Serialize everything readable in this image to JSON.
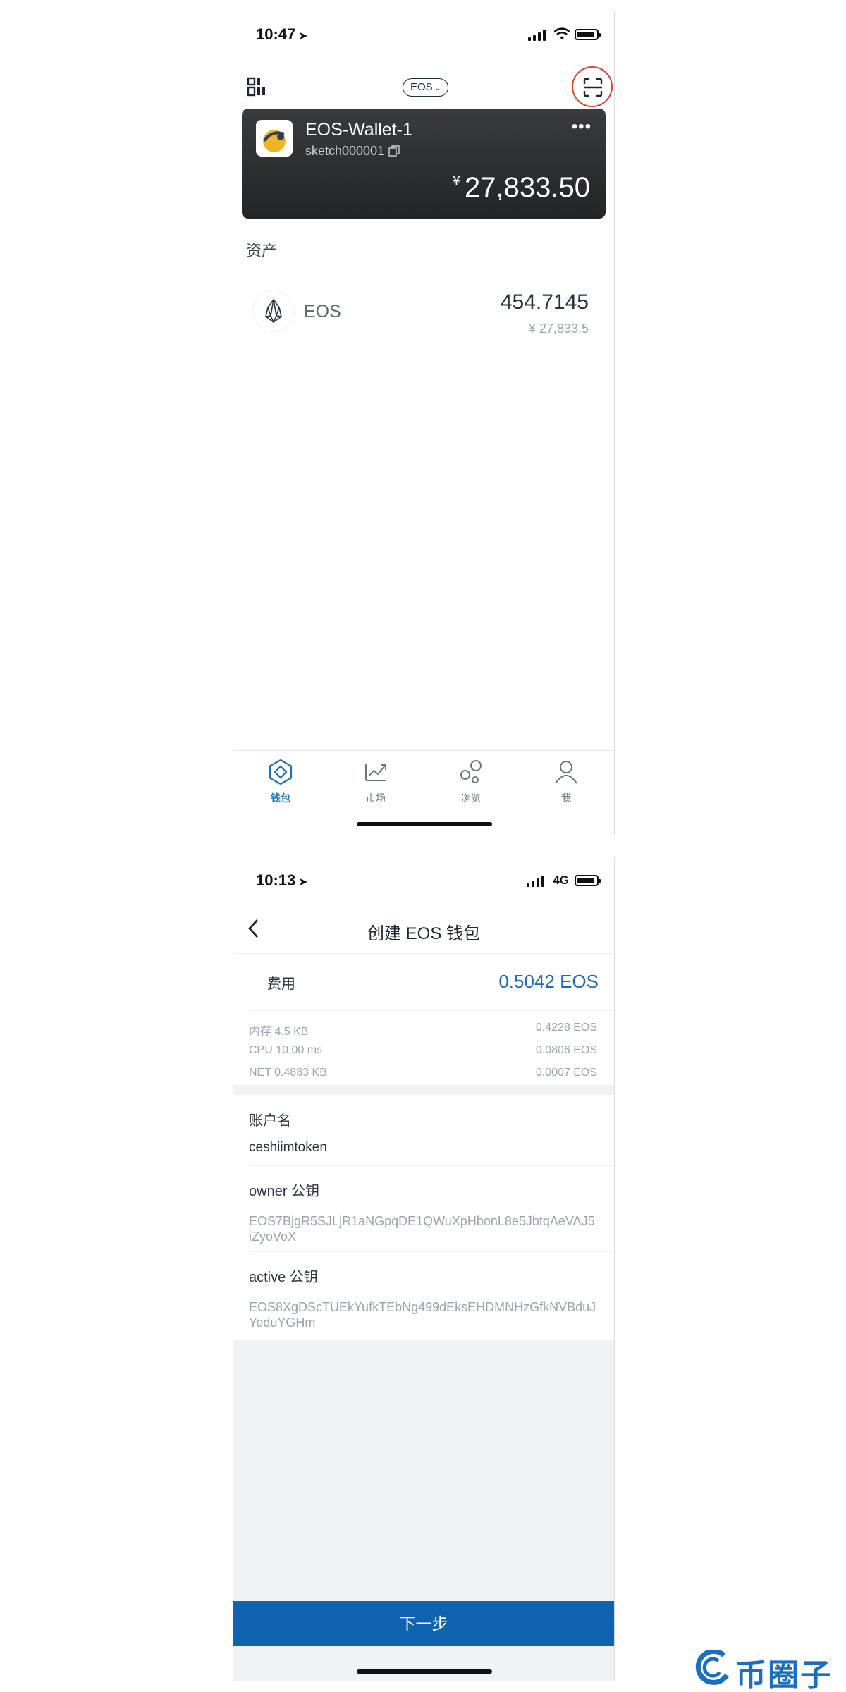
{
  "screen1": {
    "status": {
      "time": "10:47"
    },
    "topbar": {
      "chain": "EOS"
    },
    "wallet": {
      "name": "EOS-Wallet-1",
      "account": "sketch000001",
      "currency_symbol": "¥",
      "balance": "27,833.50"
    },
    "assets_title": "资产",
    "assets": [
      {
        "symbol": "EOS",
        "amount": "454.7145",
        "value": "¥ 27,833.5"
      }
    ],
    "tabs": [
      {
        "label": "钱包",
        "icon": "wallet-hexagon-icon",
        "active": true
      },
      {
        "label": "市场",
        "icon": "market-chart-icon",
        "active": false
      },
      {
        "label": "浏览",
        "icon": "browse-bubbles-icon",
        "active": false
      },
      {
        "label": "我",
        "icon": "profile-icon",
        "active": false
      }
    ]
  },
  "screen2": {
    "status": {
      "time": "10:13",
      "network": "4G"
    },
    "title": "创建 EOS 钱包",
    "fee": {
      "label": "费用",
      "total": "0.5042 EOS",
      "items": [
        {
          "label": "内存 4.5 KB",
          "value": "0.4228 EOS"
        },
        {
          "label": "CPU 10.00 ms",
          "value": "0.0806 EOS"
        },
        {
          "label": "NET 0.4883 KB",
          "value": "0.0007 EOS"
        }
      ]
    },
    "account": {
      "label": "账户名",
      "value": "ceshiimtoken"
    },
    "owner_key": {
      "label": "owner 公钥",
      "value": "EOS7BjgR5SJLjR1aNGpqDE1QWuXpHbonL8e5JbtqAeVAJ5iZyoVoX"
    },
    "active_key": {
      "label": "active 公钥",
      "value": "EOS8XgDScTUEkYufkTEbNg499dEksEHDMNHzGfkNVBduJYeduYGHm"
    },
    "next_button": "下一步"
  },
  "watermark": {
    "text": "币圈子"
  },
  "colors": {
    "accent": "#0f63b0",
    "highlight_circle": "#e0402c",
    "card": "#2b2c2e"
  }
}
